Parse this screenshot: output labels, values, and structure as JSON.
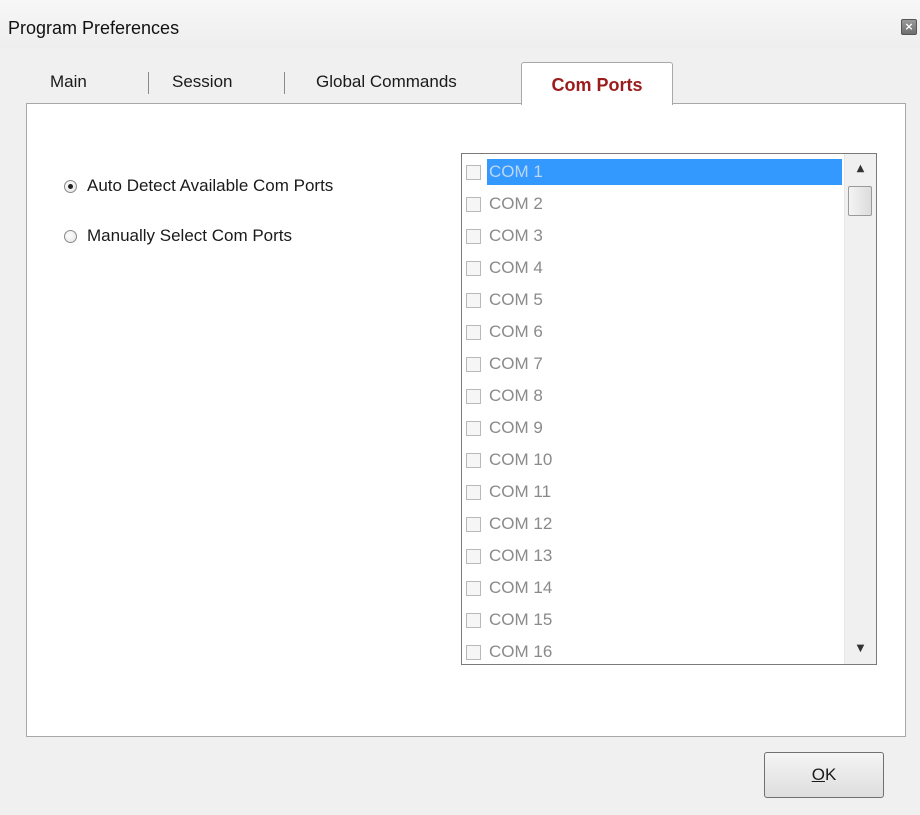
{
  "window": {
    "title": "Program Preferences",
    "close_glyph": "×"
  },
  "tabs": [
    {
      "label": "Main",
      "active": false
    },
    {
      "label": "Session",
      "active": false
    },
    {
      "label": "Global Commands",
      "active": false
    },
    {
      "label": "Com Ports",
      "active": true
    }
  ],
  "detection": {
    "options": [
      {
        "label": "Auto Detect Available Com Ports",
        "checked": true
      },
      {
        "label": "Manually Select Com Ports",
        "checked": false
      }
    ]
  },
  "com_list": {
    "items": [
      {
        "label": "COM 1",
        "checked": false,
        "selected": true
      },
      {
        "label": "COM 2",
        "checked": false,
        "selected": false
      },
      {
        "label": "COM 3",
        "checked": false,
        "selected": false
      },
      {
        "label": "COM 4",
        "checked": false,
        "selected": false
      },
      {
        "label": "COM 5",
        "checked": false,
        "selected": false
      },
      {
        "label": "COM 6",
        "checked": false,
        "selected": false
      },
      {
        "label": "COM 7",
        "checked": false,
        "selected": false
      },
      {
        "label": "COM 8",
        "checked": false,
        "selected": false
      },
      {
        "label": "COM 9",
        "checked": false,
        "selected": false
      },
      {
        "label": "COM 10",
        "checked": false,
        "selected": false
      },
      {
        "label": "COM 11",
        "checked": false,
        "selected": false
      },
      {
        "label": "COM 12",
        "checked": false,
        "selected": false
      },
      {
        "label": "COM 13",
        "checked": false,
        "selected": false
      },
      {
        "label": "COM 14",
        "checked": false,
        "selected": false
      },
      {
        "label": "COM 15",
        "checked": false,
        "selected": false
      },
      {
        "label": "COM 16",
        "checked": false,
        "selected": false
      }
    ],
    "scroll_up_glyph": "▲",
    "scroll_down_glyph": "▼"
  },
  "footer": {
    "ok_mnemonic": "O",
    "ok_rest": "K"
  },
  "colors": {
    "active_tab_text": "#9b1c1c",
    "selection": "#3399ff",
    "disabled_text": "#8a8a8a"
  }
}
